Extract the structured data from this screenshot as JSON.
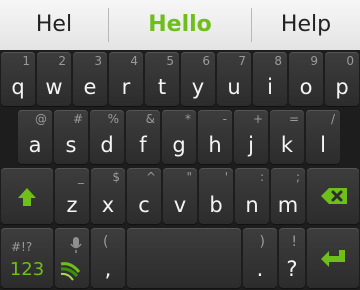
{
  "suggestions": [
    "Hel",
    "Hello",
    "Help"
  ],
  "rows": [
    [
      {
        "main": "q",
        "sub": "1"
      },
      {
        "main": "w",
        "sub": "2"
      },
      {
        "main": "e",
        "sub": "3"
      },
      {
        "main": "r",
        "sub": "4"
      },
      {
        "main": "t",
        "sub": "5"
      },
      {
        "main": "y",
        "sub": "6"
      },
      {
        "main": "u",
        "sub": "7"
      },
      {
        "main": "i",
        "sub": "8"
      },
      {
        "main": "o",
        "sub": "9"
      },
      {
        "main": "p",
        "sub": "0"
      }
    ],
    [
      {
        "main": "a",
        "sub": "@"
      },
      {
        "main": "s",
        "sub": "#"
      },
      {
        "main": "d",
        "sub": "%"
      },
      {
        "main": "f",
        "sub": "&"
      },
      {
        "main": "g",
        "sub": "*"
      },
      {
        "main": "h",
        "sub": "-"
      },
      {
        "main": "j",
        "sub": "+"
      },
      {
        "main": "k",
        "sub": "="
      },
      {
        "main": "l",
        "sub": "/"
      }
    ],
    [
      {
        "main": "z",
        "sub": "_"
      },
      {
        "main": "x",
        "sub": "$"
      },
      {
        "main": "c",
        "sub": "^"
      },
      {
        "main": "v",
        "sub": "\""
      },
      {
        "main": "b",
        "sub": "'"
      },
      {
        "main": "n",
        "sub": ":"
      },
      {
        "main": "m",
        "sub": ";"
      }
    ]
  ],
  "bottom": {
    "symbols_main": "123",
    "symbols_sub": "#!?",
    "comma_main": ",",
    "comma_sub": "(",
    "period_main": ".",
    "period_sub": ")",
    "question_main": "?",
    "question_sub": "!"
  },
  "icons": {
    "shift": "shift-arrow-icon",
    "backspace": "backspace-icon",
    "mic": "microphone-icon",
    "swype": "swype-logo-icon",
    "enter": "enter-icon"
  },
  "colors": {
    "accent": "#6fbf1a",
    "key_text": "#f4f4f4",
    "sub_text": "#9a9a9a"
  }
}
